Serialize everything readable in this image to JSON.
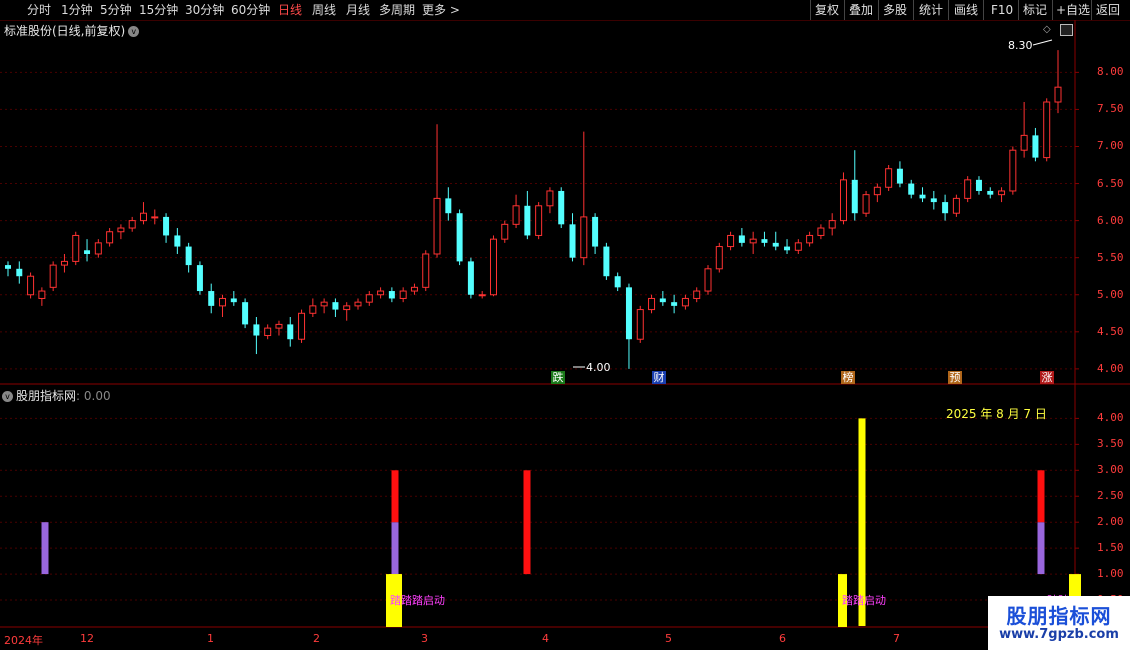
{
  "toolbar": {
    "periods": [
      "分时",
      "1分钟",
      "5分钟",
      "15分钟",
      "30分钟",
      "60分钟",
      "日线",
      "周线",
      "月线",
      "多周期",
      "更多 >"
    ],
    "active_period": "日线",
    "actions": [
      "复权",
      "叠加",
      "多股",
      "统计",
      "画线",
      "F10",
      "标记",
      "+自选",
      "返回"
    ]
  },
  "main_chart": {
    "title": "标准股份(日线,前复权)",
    "price_ticks": [
      "8.00",
      "7.50",
      "7.00",
      "6.50",
      "6.00",
      "5.50",
      "5.00",
      "4.50",
      "4.00"
    ],
    "max_label": "8.30",
    "min_label": "4.00",
    "markers": [
      {
        "text": "跌",
        "bg": "#1b7a1b"
      },
      {
        "text": "财",
        "bg": "#1a3fb0"
      },
      {
        "text": "榜",
        "bg": "#b0661a"
      },
      {
        "text": "预",
        "bg": "#b0661a"
      },
      {
        "text": "涨",
        "bg": "#b01a1a"
      }
    ]
  },
  "indicator": {
    "title": "股朋指标网",
    "value": ": 0.00",
    "date_label": "2025 年 8 月 7 日",
    "ticks": [
      "4.00",
      "3.50",
      "3.00",
      "2.50",
      "2.00",
      "1.50",
      "1.00",
      "0.50"
    ],
    "signals": [
      "踏踏踏启动",
      "踏踏启动",
      "踏踏"
    ]
  },
  "x_axis": [
    "2024年",
    "12",
    "1",
    "2",
    "3",
    "4",
    "5",
    "6",
    "7"
  ],
  "watermark": {
    "line1": "股朋指标网",
    "line2": "www.7gpzb.com"
  },
  "chart_data": {
    "type": "candlestick",
    "title": "标准股份(日线,前复权)",
    "ylim": [
      3.85,
      8.45
    ],
    "candles_approx": [
      [
        5.4,
        5.45,
        5.25,
        5.35
      ],
      [
        5.35,
        5.45,
        5.15,
        5.25
      ],
      [
        5.0,
        5.3,
        4.95,
        5.25
      ],
      [
        4.95,
        5.1,
        4.85,
        5.05
      ],
      [
        5.1,
        5.45,
        5.05,
        5.4
      ],
      [
        5.4,
        5.55,
        5.3,
        5.45
      ],
      [
        5.45,
        5.85,
        5.4,
        5.8
      ],
      [
        5.6,
        5.75,
        5.45,
        5.55
      ],
      [
        5.55,
        5.75,
        5.5,
        5.7
      ],
      [
        5.7,
        5.9,
        5.65,
        5.85
      ],
      [
        5.85,
        5.95,
        5.75,
        5.9
      ],
      [
        5.9,
        6.05,
        5.85,
        6.0
      ],
      [
        6.0,
        6.25,
        5.95,
        6.1
      ],
      [
        6.05,
        6.15,
        5.95,
        6.05
      ],
      [
        6.05,
        6.1,
        5.7,
        5.8
      ],
      [
        5.8,
        5.9,
        5.55,
        5.65
      ],
      [
        5.65,
        5.7,
        5.3,
        5.4
      ],
      [
        5.4,
        5.45,
        5.0,
        5.05
      ],
      [
        5.05,
        5.15,
        4.75,
        4.85
      ],
      [
        4.85,
        5.0,
        4.7,
        4.95
      ],
      [
        4.95,
        5.05,
        4.85,
        4.9
      ],
      [
        4.9,
        4.95,
        4.55,
        4.6
      ],
      [
        4.6,
        4.7,
        4.2,
        4.45
      ],
      [
        4.45,
        4.6,
        4.4,
        4.55
      ],
      [
        4.55,
        4.65,
        4.45,
        4.6
      ],
      [
        4.6,
        4.7,
        4.3,
        4.4
      ],
      [
        4.4,
        4.8,
        4.35,
        4.75
      ],
      [
        4.75,
        4.95,
        4.7,
        4.85
      ],
      [
        4.85,
        4.95,
        4.75,
        4.9
      ],
      [
        4.9,
        4.95,
        4.7,
        4.8
      ],
      [
        4.8,
        4.9,
        4.65,
        4.85
      ],
      [
        4.85,
        4.95,
        4.8,
        4.9
      ],
      [
        4.9,
        5.05,
        4.85,
        5.0
      ],
      [
        5.0,
        5.1,
        4.95,
        5.05
      ],
      [
        5.05,
        5.1,
        4.9,
        4.95
      ],
      [
        4.95,
        5.1,
        4.9,
        5.05
      ],
      [
        5.05,
        5.15,
        5.0,
        5.1
      ],
      [
        5.1,
        5.6,
        5.05,
        5.55
      ],
      [
        5.55,
        7.3,
        5.5,
        6.3
      ],
      [
        6.3,
        6.45,
        6.0,
        6.1
      ],
      [
        6.1,
        6.15,
        5.4,
        5.45
      ],
      [
        5.45,
        5.5,
        4.95,
        5.0
      ],
      [
        5.0,
        5.05,
        4.95,
        5.0
      ],
      [
        5.0,
        5.8,
        4.98,
        5.75
      ],
      [
        5.75,
        6.0,
        5.7,
        5.95
      ],
      [
        5.95,
        6.35,
        5.9,
        6.2
      ],
      [
        6.2,
        6.4,
        5.75,
        5.8
      ],
      [
        5.8,
        6.25,
        5.75,
        6.2
      ],
      [
        6.2,
        6.45,
        6.1,
        6.4
      ],
      [
        6.4,
        6.45,
        5.9,
        5.95
      ],
      [
        5.95,
        6.1,
        5.45,
        5.5
      ],
      [
        5.5,
        7.2,
        5.4,
        6.05
      ],
      [
        6.05,
        6.1,
        5.55,
        5.65
      ],
      [
        5.65,
        5.7,
        5.2,
        5.25
      ],
      [
        5.25,
        5.3,
        5.05,
        5.1
      ],
      [
        5.1,
        5.15,
        4.0,
        4.4
      ],
      [
        4.4,
        4.85,
        4.35,
        4.8
      ],
      [
        4.8,
        5.0,
        4.75,
        4.95
      ],
      [
        4.95,
        5.05,
        4.85,
        4.9
      ],
      [
        4.9,
        5.0,
        4.75,
        4.85
      ],
      [
        4.85,
        5.0,
        4.8,
        4.95
      ],
      [
        4.95,
        5.1,
        4.9,
        5.05
      ],
      [
        5.05,
        5.4,
        5.0,
        5.35
      ],
      [
        5.35,
        5.7,
        5.3,
        5.65
      ],
      [
        5.65,
        5.85,
        5.6,
        5.8
      ],
      [
        5.8,
        5.9,
        5.65,
        5.7
      ],
      [
        5.7,
        5.85,
        5.55,
        5.75
      ],
      [
        5.75,
        5.85,
        5.65,
        5.7
      ],
      [
        5.7,
        5.85,
        5.6,
        5.65
      ],
      [
        5.65,
        5.75,
        5.55,
        5.6
      ],
      [
        5.6,
        5.75,
        5.55,
        5.7
      ],
      [
        5.7,
        5.85,
        5.65,
        5.8
      ],
      [
        5.8,
        5.95,
        5.75,
        5.9
      ],
      [
        5.9,
        6.1,
        5.8,
        6.0
      ],
      [
        6.0,
        6.65,
        5.95,
        6.55
      ],
      [
        6.55,
        6.95,
        6.0,
        6.1
      ],
      [
        6.1,
        6.4,
        6.05,
        6.35
      ],
      [
        6.35,
        6.5,
        6.25,
        6.45
      ],
      [
        6.45,
        6.75,
        6.4,
        6.7
      ],
      [
        6.7,
        6.8,
        6.45,
        6.5
      ],
      [
        6.5,
        6.55,
        6.3,
        6.35
      ],
      [
        6.35,
        6.45,
        6.25,
        6.3
      ],
      [
        6.3,
        6.4,
        6.15,
        6.25
      ],
      [
        6.25,
        6.35,
        6.0,
        6.1
      ],
      [
        6.1,
        6.35,
        6.05,
        6.3
      ],
      [
        6.3,
        6.6,
        6.25,
        6.55
      ],
      [
        6.55,
        6.6,
        6.35,
        6.4
      ],
      [
        6.4,
        6.45,
        6.3,
        6.35
      ],
      [
        6.35,
        6.45,
        6.25,
        6.4
      ],
      [
        6.4,
        7.0,
        6.35,
        6.95
      ],
      [
        6.95,
        7.6,
        6.85,
        7.15
      ],
      [
        7.15,
        7.25,
        6.8,
        6.85
      ],
      [
        6.85,
        7.65,
        6.8,
        7.6
      ],
      [
        7.6,
        8.3,
        7.45,
        7.8
      ]
    ],
    "indicator": {
      "type": "bar",
      "ylim": [
        0,
        4.2
      ],
      "bars": [
        {
          "pos": 0.045,
          "from": 1,
          "to": 2,
          "color": "#9966dd"
        },
        {
          "pos": 0.395,
          "from": 0,
          "to": 1,
          "color": "#ffff00"
        },
        {
          "pos": 0.395,
          "from": 1,
          "to": 2,
          "color": "#9966dd"
        },
        {
          "pos": 0.395,
          "from": 2,
          "to": 3,
          "color": "#ff1010"
        },
        {
          "pos": 0.527,
          "from": 1,
          "to": 3,
          "color": "#ff1010"
        },
        {
          "pos": 0.862,
          "from": 0,
          "to": 4,
          "color": "#ffff00"
        },
        {
          "pos": 1.041,
          "from": 1,
          "to": 2,
          "color": "#9966dd"
        },
        {
          "pos": 1.041,
          "from": 2,
          "to": 3,
          "color": "#ff1010"
        },
        {
          "pos": 1.075,
          "from": 0,
          "to": 1,
          "color": "#ffff00"
        }
      ]
    }
  }
}
